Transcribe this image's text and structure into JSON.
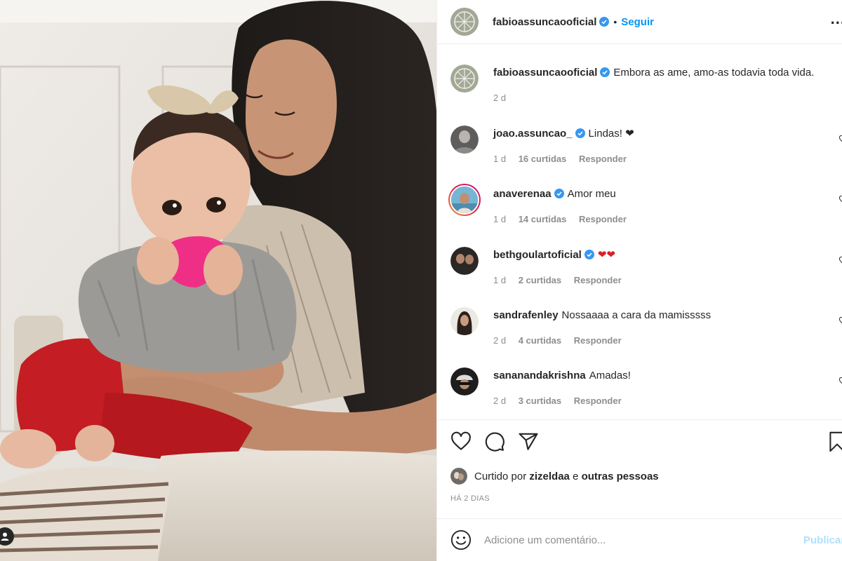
{
  "post": {
    "author": "fabioassuncaooficial",
    "follow_label": "Seguir",
    "separator": "•",
    "more_label": "...",
    "caption": "Embora as ame, amo-as todavia toda vida.",
    "caption_time": "2 d"
  },
  "comments": [
    {
      "user": "joao.assuncao_",
      "verified": true,
      "text": "Lindas! ❤",
      "time": "1 d",
      "likes": "16 curtidas",
      "reply": "Responder"
    },
    {
      "user": "anaverenaa",
      "verified": true,
      "text": "Amor meu",
      "time": "1 d",
      "likes": "14 curtidas",
      "reply": "Responder"
    },
    {
      "user": "bethgoulartoficial",
      "verified": true,
      "text": "❤❤",
      "time": "1 d",
      "likes": "2 curtidas",
      "reply": "Responder"
    },
    {
      "user": "sandrafenley",
      "verified": false,
      "text": "Nossaaaa a cara da mamisssss",
      "time": "2 d",
      "likes": "4 curtidas",
      "reply": "Responder"
    },
    {
      "user": "sananandakrishna",
      "verified": false,
      "text": "Amadas!",
      "time": "2 d",
      "likes": "3 curtidas",
      "reply": "Responder"
    }
  ],
  "likes": {
    "prefix": "Curtido por",
    "user": "zizeldaa",
    "connector": "e",
    "others": "outras pessoas"
  },
  "date_label": "HÁ 2 DIAS",
  "add_comment": {
    "placeholder": "Adicione um comentário...",
    "publish_label": "Publicar"
  },
  "colors": {
    "link_blue": "#0095f6",
    "verified_blue": "#3897f0",
    "publish_disabled": "#b2dffc",
    "heart_red": "#ed4956",
    "meta_grey": "#8e8e8e"
  },
  "icons": [
    "heart-icon",
    "comment-icon",
    "share-icon",
    "bookmark-icon",
    "emoji-icon",
    "verified-icon",
    "user-tag-icon",
    "more-icon"
  ]
}
